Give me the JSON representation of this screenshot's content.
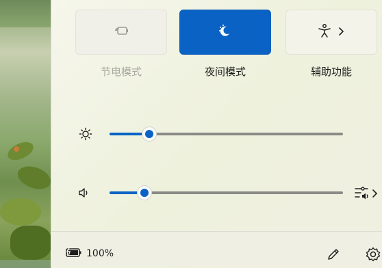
{
  "tiles": [
    {
      "label": "节电模式",
      "state": "disabled",
      "icon": "battery-saver-icon"
    },
    {
      "label": "夜间模式",
      "state": "on",
      "icon": "night-light-icon"
    },
    {
      "label": "辅助功能",
      "state": "off",
      "icon": "accessibility-icon"
    }
  ],
  "sliders": {
    "brightness": {
      "icon": "brightness-icon",
      "level": 0.17
    },
    "volume": {
      "icon": "speaker-icon",
      "level": 0.15
    }
  },
  "footer": {
    "battery_text": "100%",
    "battery_icon": "battery-charging-icon",
    "edit_icon": "pencil-icon",
    "settings_icon": "gear-icon"
  },
  "colors": {
    "accent": "#0a63c4",
    "track": "#8a8a86"
  }
}
